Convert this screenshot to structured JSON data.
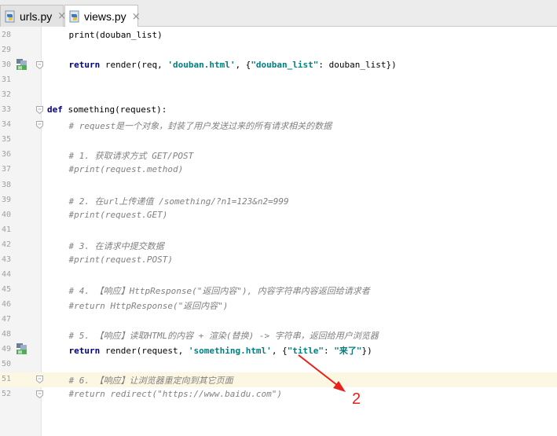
{
  "tabs": [
    {
      "label": "urls.py",
      "close": "×",
      "active": false
    },
    {
      "label": "views.py",
      "close": "×",
      "active": true
    }
  ],
  "lines": [
    {
      "num": "28",
      "code": "    print(douban_list)"
    },
    {
      "num": "29",
      "code": ""
    },
    {
      "num": "30",
      "code_parts": [
        "    ",
        "return",
        " render(req, ",
        "'douban.html'",
        ", {",
        "\"douban_list\"",
        ": douban_list})"
      ]
    },
    {
      "num": "31",
      "code": ""
    },
    {
      "num": "32",
      "code": ""
    },
    {
      "num": "33",
      "code_parts": [
        "def",
        " something(request):"
      ]
    },
    {
      "num": "34",
      "comment": "    # request是一个对象，封装了用户发送过来的所有请求相关的数据"
    },
    {
      "num": "35",
      "code": ""
    },
    {
      "num": "36",
      "comment": "    # 1. 获取请求方式 GET/POST"
    },
    {
      "num": "37",
      "comment": "    #print(request.method)"
    },
    {
      "num": "38",
      "code": ""
    },
    {
      "num": "39",
      "comment": "    # 2. 在url上传递值 /something/?n1=123&n2=999"
    },
    {
      "num": "40",
      "comment": "    #print(request.GET)"
    },
    {
      "num": "41",
      "code": ""
    },
    {
      "num": "42",
      "comment": "    # 3. 在请求中提交数据"
    },
    {
      "num": "43",
      "comment": "    #print(request.POST)"
    },
    {
      "num": "44",
      "code": ""
    },
    {
      "num": "45",
      "comment": "    # 4. 【响应】HttpResponse(\"返回内容\"), 内容字符串内容返回给请求者"
    },
    {
      "num": "46",
      "comment": "    #return HttpResponse(\"返回内容\")"
    },
    {
      "num": "47",
      "code": ""
    },
    {
      "num": "48",
      "comment": "    # 5. 【响应】读取HTML的内容 + 渲染(替换) -> 字符串，返回给用户浏览器"
    },
    {
      "num": "49",
      "code_parts": [
        "    ",
        "return",
        " render(request, ",
        "'something.html'",
        ", {",
        "\"title\"",
        ": ",
        "\"来了\"",
        "})"
      ]
    },
    {
      "num": "50",
      "code": ""
    },
    {
      "num": "51",
      "comment": "    # 6. 【响应】让浏览器重定向到其它页面"
    },
    {
      "num": "52",
      "comment": "    #return redirect(\"https://www.baidu.com\")"
    }
  ],
  "annotation": "2",
  "colors": {
    "keyword": "#000080",
    "string": "#008080",
    "comment": "#808080",
    "current_line": "#fcf7e2",
    "annotation": "#e8221a"
  },
  "icons": [
    "python-file-icon",
    "gutter-h-marker-icon",
    "fold-icon"
  ]
}
